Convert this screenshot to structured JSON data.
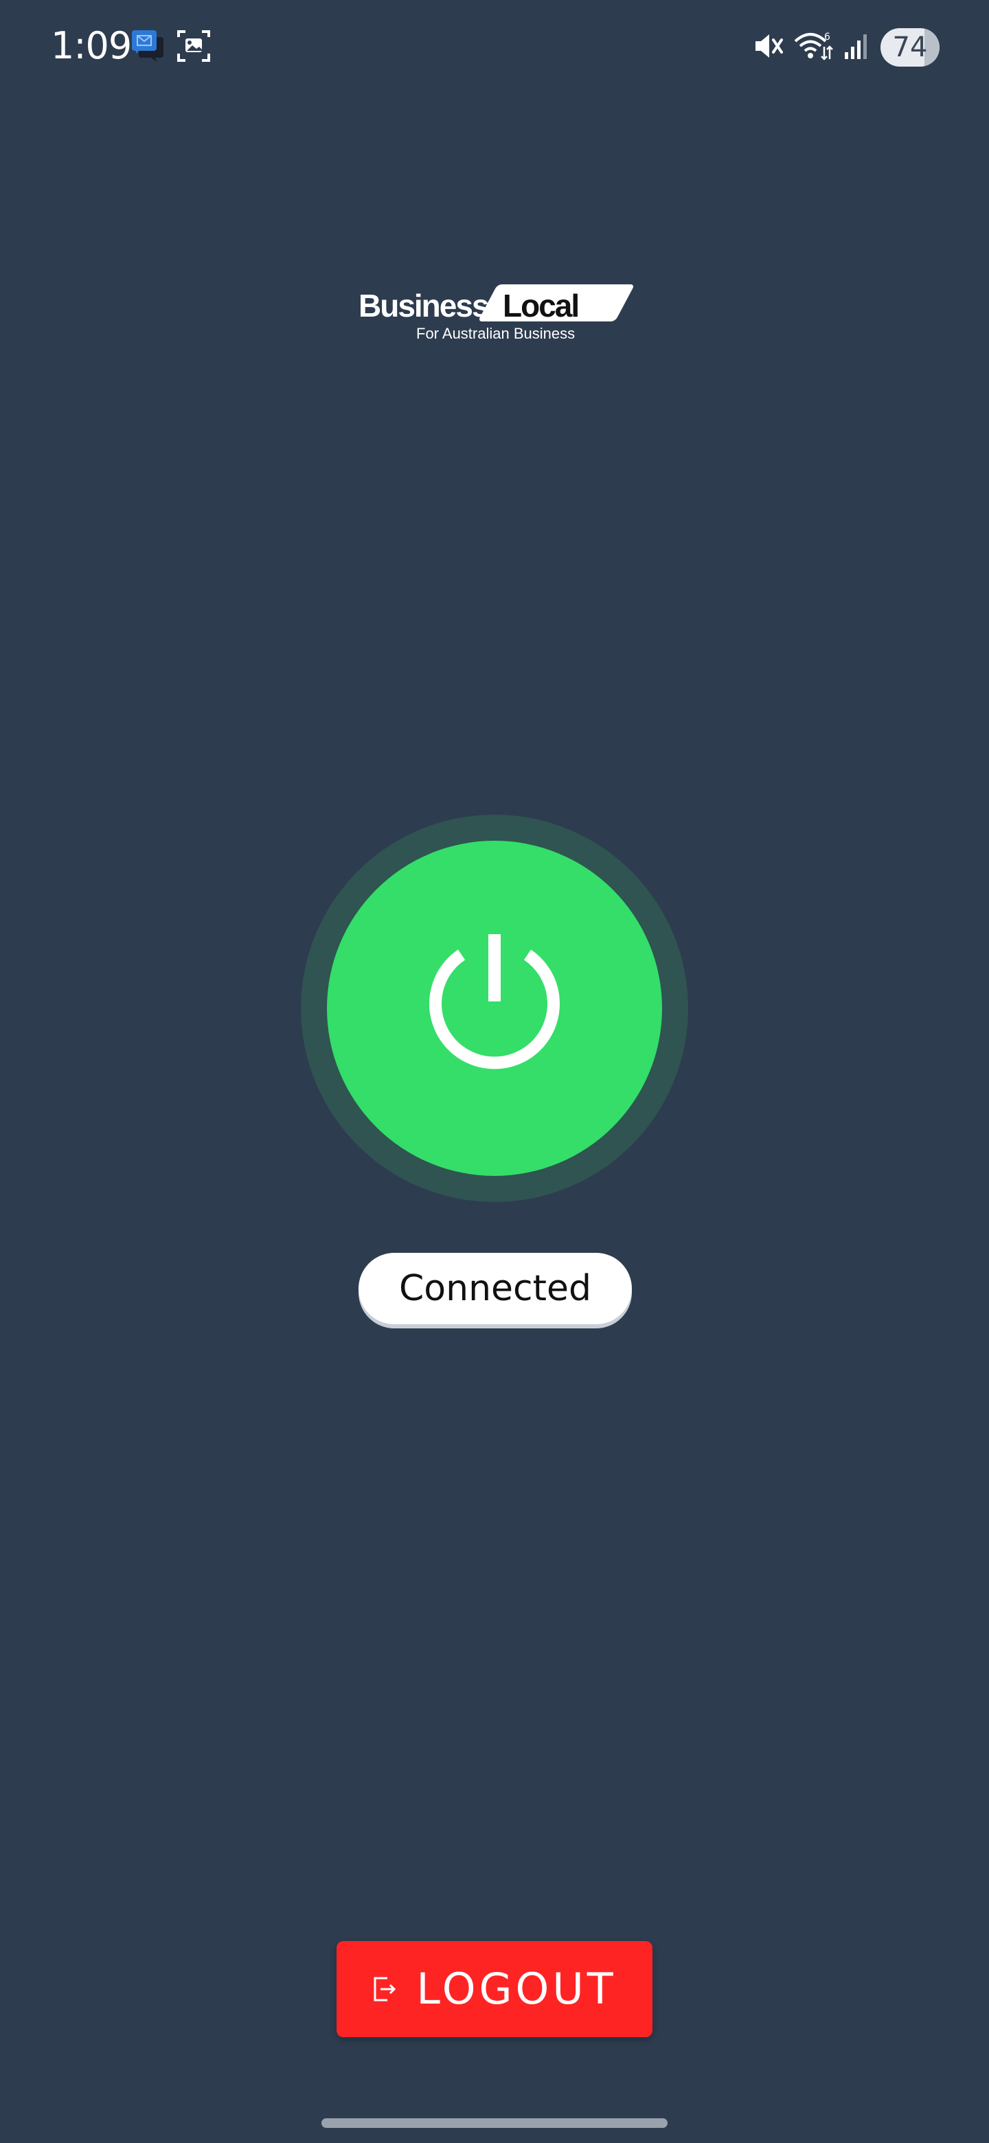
{
  "status_bar": {
    "time": "1:09",
    "battery_level": "74",
    "icons": [
      "message-icon",
      "screenshot-icon",
      "mute-icon",
      "wifi-icon",
      "signal-icon",
      "battery-icon"
    ]
  },
  "logo": {
    "brand_first": "Business",
    "brand_second": "Local",
    "tagline": "For Australian Business"
  },
  "power": {
    "icon": "power-icon",
    "state": "connected"
  },
  "connection": {
    "status_text": "Connected"
  },
  "logout": {
    "label": "LOGOUT",
    "icon": "logout-icon"
  },
  "colors": {
    "background": "#2e3c4f",
    "power_active": "#34de69",
    "power_ring": "#2f5451",
    "logout": "#ff2424",
    "pill": "#ffffff"
  }
}
